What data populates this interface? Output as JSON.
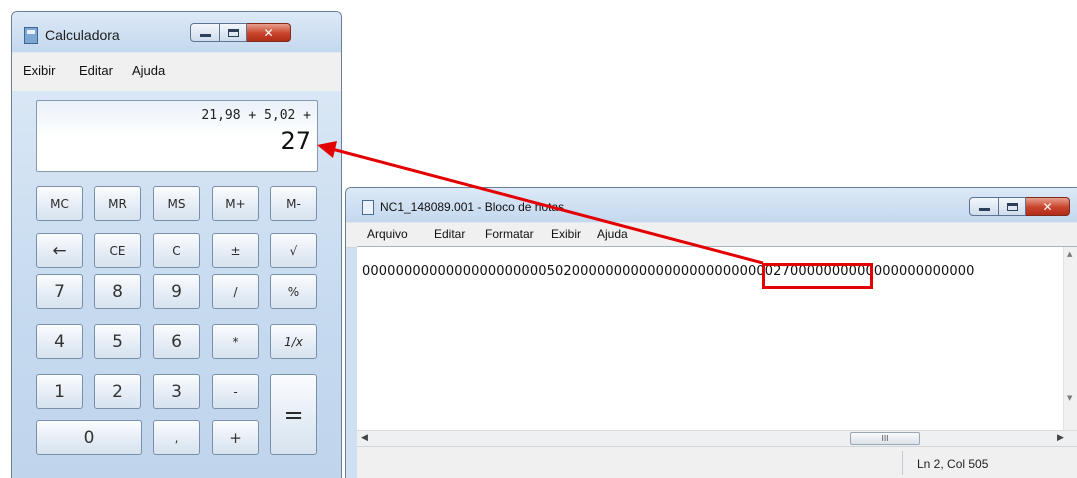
{
  "calculator": {
    "title": "Calculadora",
    "menu": [
      "Exibir",
      "Editar",
      "Ajuda"
    ],
    "display": {
      "expression": "21,98 + 5,02 +",
      "result": "27"
    },
    "keys": {
      "mc": "MC",
      "mr": "MR",
      "ms": "MS",
      "mplus": "M+",
      "mminus": "M-",
      "backspace": "←",
      "ce": "CE",
      "c": "C",
      "plusminus": "±",
      "sqrt": "√",
      "k7": "7",
      "k8": "8",
      "k9": "9",
      "divide": "/",
      "percent": "%",
      "k4": "4",
      "k5": "5",
      "k6": "6",
      "multiply": "*",
      "reciprocal": "1/x",
      "k1": "1",
      "k2": "2",
      "k3": "3",
      "minus": "-",
      "equals": "=",
      "k0": "0",
      "decimal": ",",
      "plus": "+"
    }
  },
  "notepad": {
    "title": "NC1_148089.001 - Bloco de notas",
    "menu": [
      "Arquivo",
      "Editar",
      "Formatar",
      "Exibir",
      "Ajuda"
    ],
    "content": "0000000000000000000000502000000000000000000000000270000000000000000000000",
    "scroll_thumb": "III",
    "status": "Ln 2, Col 505"
  },
  "annotation": {
    "color": "#e30000"
  }
}
